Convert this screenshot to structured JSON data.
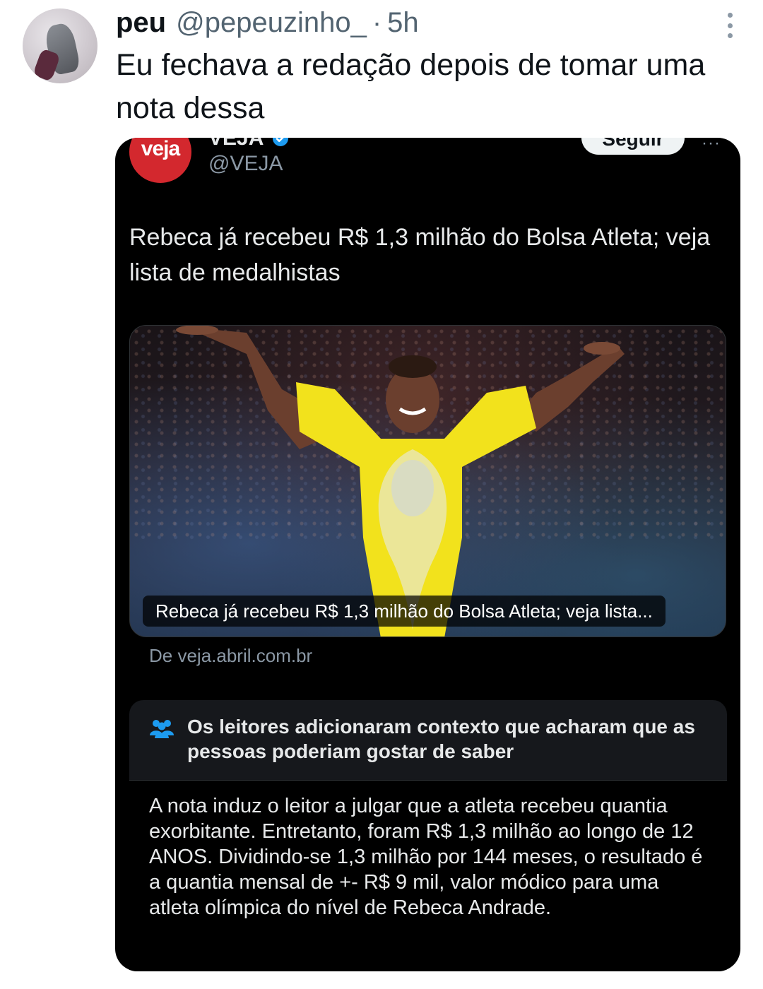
{
  "outer_tweet": {
    "name": "peu",
    "handle": "@pepeuzinho_",
    "separator": "·",
    "time": "5h",
    "text": "Eu fechava a redação depois de tomar uma nota dessa"
  },
  "embedded_tweet": {
    "logo_text": "veja",
    "name": "VEJA",
    "handle": "@VEJA",
    "follow_label": "Seguir",
    "more_label": "···",
    "text": "Rebeca já recebeu R$ 1,3 milhão do Bolsa Atleta; veja lista de medalhistas",
    "link_card": {
      "caption": "Rebeca já recebeu R$ 1,3 milhão do Bolsa Atleta; veja lista...",
      "source": "De veja.abril.com.br"
    },
    "community_note": {
      "icon": "people-icon",
      "title": "Os leitores adicionaram contexto que acharam que as pessoas poderiam gostar de saber",
      "body": "A nota induz o leitor a julgar que a atleta recebeu quantia exorbitante. Entretanto, foram R$ 1,3 milhão ao longo de 12 ANOS. Dividindo-se 1,3 milhão por 144 meses, o resultado é a quantia mensal de +- R$ 9 mil, valor módico para uma atleta olímpica do nível de Rebeca Andrade."
    }
  },
  "colors": {
    "accent_blue": "#1d9bf0",
    "veja_red": "#d3282e",
    "leotard_yellow": "#f2e21c"
  }
}
